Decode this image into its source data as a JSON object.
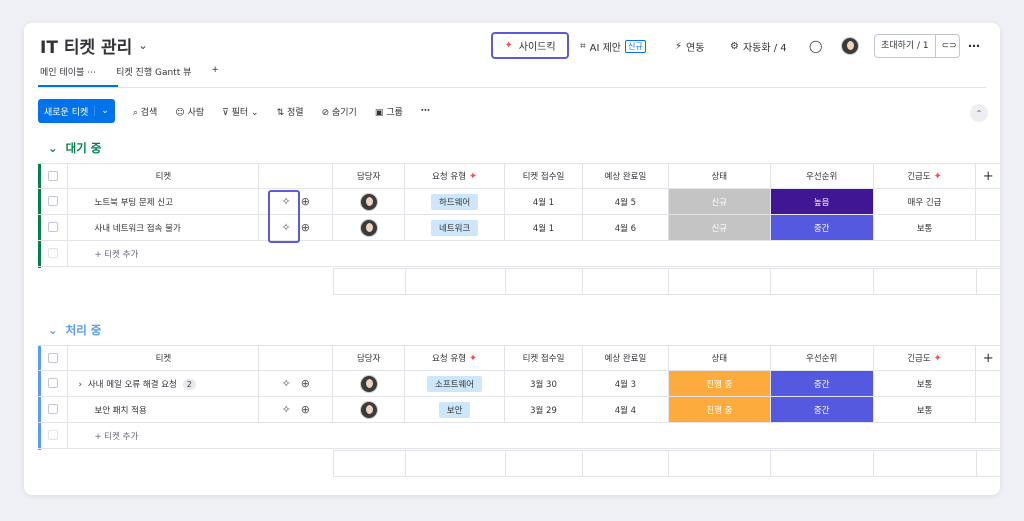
{
  "board": {
    "title": "IT 티켓 관리",
    "sidekick_label": "사이드킥",
    "ai_label": "AI 제안",
    "ai_badge": "신규",
    "integrate_label": "연동",
    "automation_label": "자동화 / 4",
    "invite_label": "초대하기 / 1"
  },
  "tabs": [
    {
      "label": "메인 테이블"
    },
    {
      "label": "티켓 진행 Gantt 뷰"
    }
  ],
  "toolbar": {
    "new_ticket": "새로운 티켓",
    "search": "검색",
    "person": "사람",
    "filter": "필터",
    "sort": "정렬",
    "hide": "숨기기",
    "group": "그룹"
  },
  "columns": [
    "티켓",
    "담당자",
    "요청 유형",
    "티켓 접수일",
    "예상 완료일",
    "상태",
    "우선순위",
    "긴급도"
  ],
  "colors": {
    "accent": "#0073ea",
    "highlight": "#5c5ad9",
    "group1": "#037f4c",
    "group2": "#579bfc",
    "status_new": "#c4c4c4",
    "status_progress": "#fdab3d",
    "priority_high": "#401694",
    "priority_mid": "#5559df"
  },
  "groups": [
    {
      "title": "대기 중",
      "add_label": "+ 티켓 추가",
      "rows": [
        {
          "name": "노트북 부팅 문제 신고",
          "type": "하드웨어",
          "received": "4월 1",
          "due": "4월 5",
          "status": "신규",
          "priority": "높음",
          "urgency": "매우 긴급"
        },
        {
          "name": "사내 네트워크 접속 불가",
          "type": "네트워크",
          "received": "4월 1",
          "due": "4월 6",
          "status": "신규",
          "priority": "중간",
          "urgency": "보통"
        }
      ]
    },
    {
      "title": "처리 중",
      "add_label": "+ 티켓 추가",
      "rows": [
        {
          "name": "사내 메일 오류 해결 요청",
          "subitems": "2",
          "type": "소프트웨어",
          "received": "3월 30",
          "due": "4월 3",
          "status": "진행 중",
          "priority": "중간",
          "urgency": "보통"
        },
        {
          "name": "보안 패치 적용",
          "type": "보안",
          "received": "3월 29",
          "due": "4월 4",
          "status": "진행 중",
          "priority": "중간",
          "urgency": "보통"
        }
      ]
    }
  ]
}
